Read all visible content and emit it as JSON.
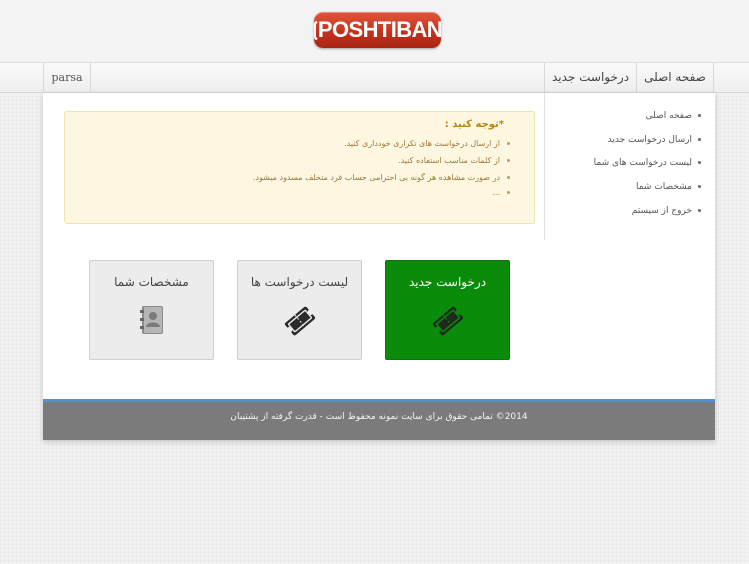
{
  "brand": {
    "logo_text": "POSHTIBAN"
  },
  "nav": {
    "home_label": "صفحه اصلی",
    "new_request_label": "درخواست جدید",
    "user_label": "parsa"
  },
  "sidebar": {
    "items": [
      {
        "label": "صفحه اصلی"
      },
      {
        "label": "ارسال درخواست جدید"
      },
      {
        "label": "لیست درخواست های شما"
      },
      {
        "label": "مشخصات شما"
      },
      {
        "label": "خروج از سیستم"
      }
    ]
  },
  "notice": {
    "title": "*توجه کنید :",
    "lines": [
      "از ارسال درخواست های تکراری خودداری کنید.",
      "از کلمات مناسب استفاده کنید.",
      "در صورت مشاهده هر گونه بی احترامی حساب فرد متخلف مسدود میشود.",
      "..."
    ]
  },
  "tiles": [
    {
      "label": "درخواست جدید",
      "icon": "ticket-icon",
      "color": "#0a8c0a"
    },
    {
      "label": "لیست درخواست ها",
      "icon": "ticket-icon"
    },
    {
      "label": "مشخصات شما",
      "icon": "address-book-icon"
    }
  ],
  "footer": {
    "text": "2014© تمامی حقوق برای سایت نمونه محفوظ است - قدرت گرفته از پشتیبان"
  },
  "colors": {
    "accent_green": "#0a8c0a",
    "footer_bg": "#7b7b7b",
    "footer_border": "#4f8fd6",
    "logo_red": "#c2331f"
  }
}
